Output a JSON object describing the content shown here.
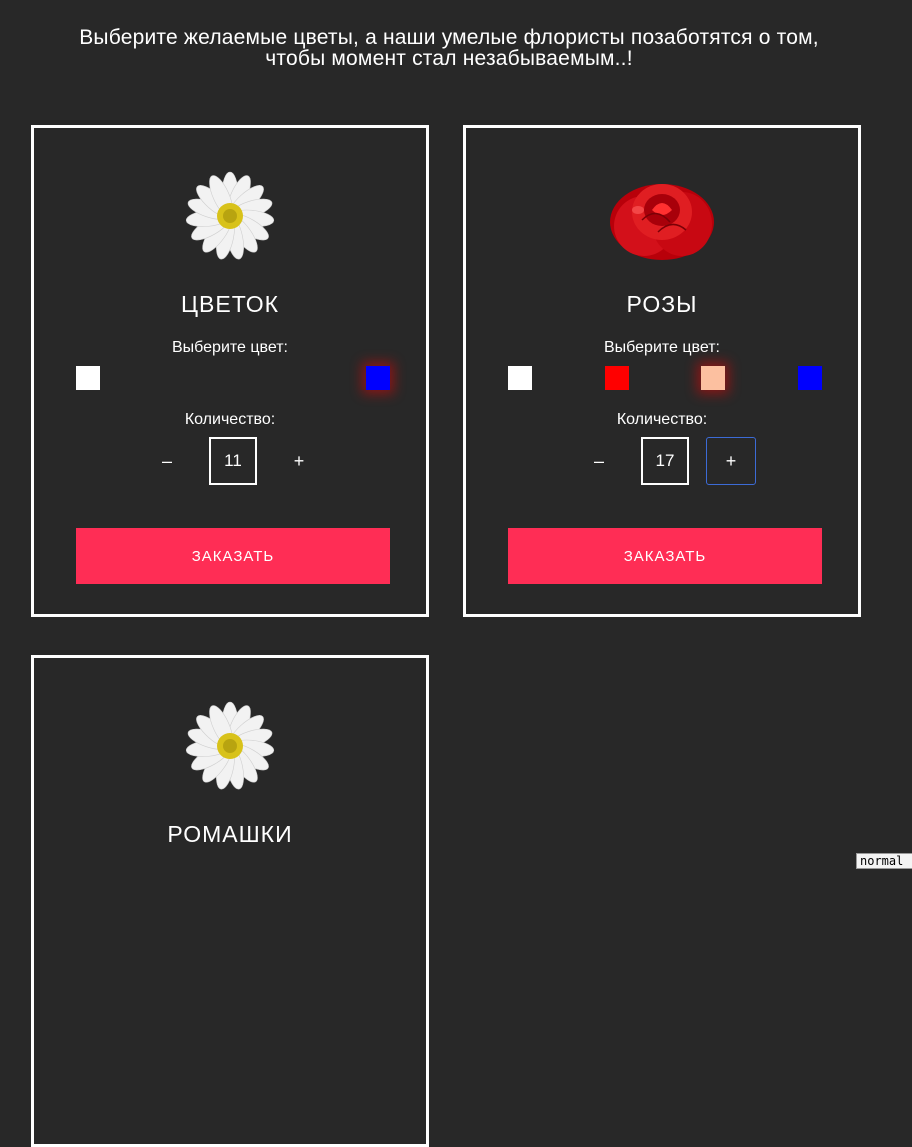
{
  "intro": {
    "line1": "Выберите желаемые цветы, а наши умелые флористы позаботятся о том,",
    "line2": "чтобы момент стал незабываемым..!"
  },
  "cards": [
    {
      "title": "ЦВЕТОК",
      "image": "daisy-icon",
      "color_label": "Выберите цвет:",
      "colors": [
        "#ffffff",
        "#0000ff"
      ],
      "selected_color": "#0000ff",
      "qty_label": "Количество:",
      "minus": "–",
      "quantity": "11",
      "plus": "+",
      "order": "ЗАКАЗАТЬ"
    },
    {
      "title": "РОЗЫ",
      "image": "rose-icon",
      "color_label": "Выберите цвет:",
      "colors": [
        "#ffffff",
        "#ff0000",
        "#fcc0a0",
        "#0000ff"
      ],
      "selected_color": "#fcc0a0",
      "qty_label": "Количество:",
      "minus": "–",
      "quantity": "17",
      "plus": "+",
      "order": "ЗАКАЗАТЬ"
    },
    {
      "title": "РОМАШКИ",
      "image": "daisy-icon"
    }
  ],
  "tooltip": "normal"
}
